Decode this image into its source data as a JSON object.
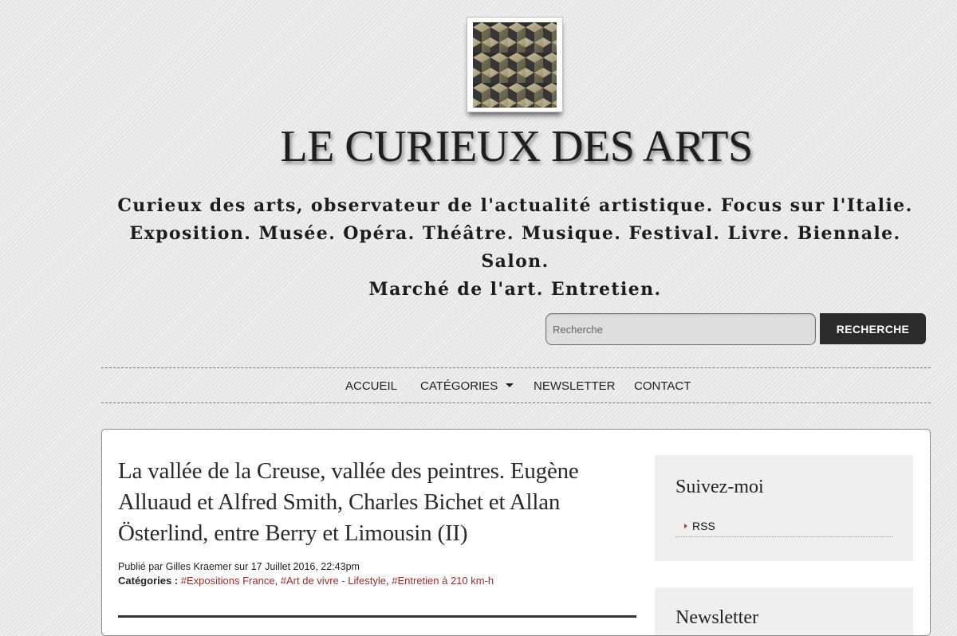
{
  "site": {
    "title": "LE CURIEUX DES ARTS",
    "tagline": "Curieux des arts, observateur de l'actualité artistique. Focus sur l'Italie.\nExposition. Musée. Opéra. Théâtre. Musique. Festival. Livre. Biennale. Salon.\nMarché de l'art. Entretien."
  },
  "search": {
    "placeholder": "Recherche",
    "value": "",
    "button_label": "RECHERCHE"
  },
  "nav": {
    "items": [
      {
        "label": "ACCUEIL"
      },
      {
        "label": "CATÉGORIES",
        "icon": "caret-down-icon"
      },
      {
        "label": "NEWSLETTER"
      },
      {
        "label": "CONTACT"
      }
    ]
  },
  "post": {
    "title": "La vallée de la Creuse, vallée des peintres. Eugène Alluaud et Alfred Smith, Charles Bichet et Allan Österlind, entre Berry et Limousin (II)",
    "meta": "Publié par Gilles Kraemer sur 17 Juillet 2016, 22:43pm",
    "categories_label": "Catégories :",
    "categories": [
      "#Expositions France",
      "#Art de vivre - Lifestyle",
      "#Entretien à 210 km-h"
    ]
  },
  "sidebar": {
    "widget_follow": {
      "title": "Suivez-moi",
      "items": [
        {
          "label": "RSS"
        }
      ]
    },
    "widget_newsletter": {
      "title": "Newsletter"
    }
  },
  "colors": {
    "link": "#9a2b2b",
    "button_bg": "#2b2b2b",
    "rss_bullet": "#b03a2e"
  }
}
